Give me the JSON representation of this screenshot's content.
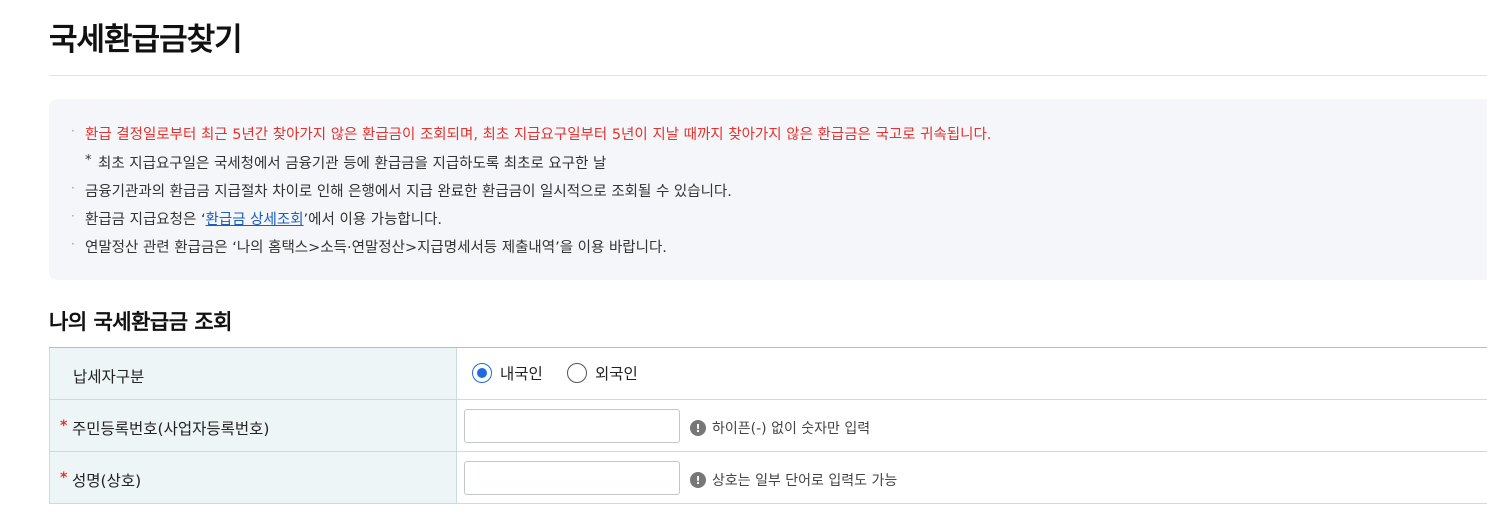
{
  "page": {
    "title": "국세환급금찾기"
  },
  "notice": {
    "items": [
      {
        "bullet": "·",
        "text": "환급 결정일로부터 최근 5년간 찾아가지 않은 환급금이 조회되며, 최초 지급요구일부터 5년이 지날 때까지 찾아가지 않은 환급금은 국고로 귀속됩니다."
      },
      {
        "star": "*",
        "text": "최초 지급요구일은 국세청에서 금융기관 등에 환급금을 지급하도록 최초로 요구한 날"
      },
      {
        "bullet": "·",
        "text": "금융기관과의 환급금 지급절차 차이로 인해 은행에서 지급 완료한 환급금이 일시적으로 조회될 수 있습니다."
      },
      {
        "bullet": "·",
        "text_before": "환급금 지급요청은 ‘",
        "link": "환급금 상세조회",
        "text_after": "’에서 이용 가능합니다."
      },
      {
        "bullet": "·",
        "text": "연말정산 관련 환급금은 ‘나의 홈택스>소득·연말정산>지급명세서등 제출내역’을 이용 바랍니다."
      }
    ],
    "highlight_color": "#e5322d"
  },
  "section": {
    "title": "나의 국세환급금 조회"
  },
  "form": {
    "taxpayer_type": {
      "label": "납세자구분",
      "options": [
        {
          "label": "내국인",
          "checked": true
        },
        {
          "label": "외국인",
          "checked": false
        }
      ]
    },
    "resident_number": {
      "required_mark": "*",
      "label": "주민등록번호(사업자등록번호)",
      "value": "",
      "hint_icon": "!",
      "hint": "하이픈(-) 없이 숫자만 입력"
    },
    "name": {
      "required_mark": "*",
      "label": "성명(상호)",
      "value": "",
      "hint_icon": "!",
      "hint": "상호는 일부 단어로 입력도 가능"
    }
  },
  "colors": {
    "accent": "#1e6bdc",
    "label_bg": "#edf5f6",
    "notice_bg": "#f4f6f9",
    "link": "#1a5fbf"
  }
}
